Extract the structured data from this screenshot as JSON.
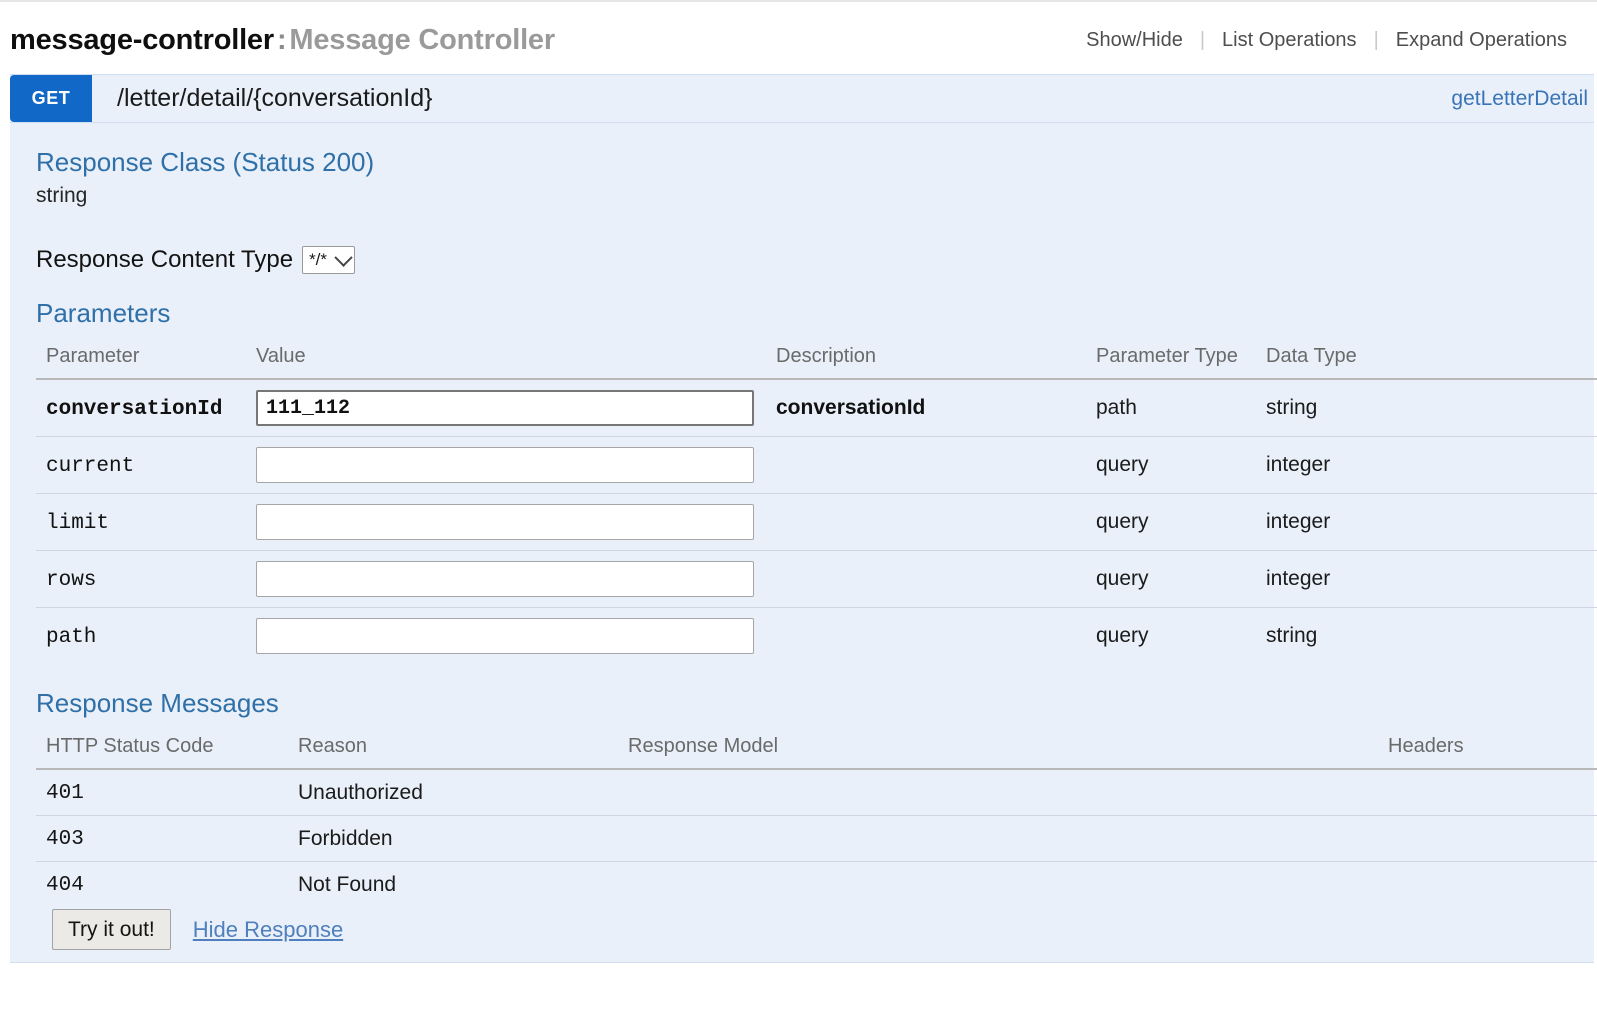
{
  "resource": {
    "name": "message-controller",
    "separator": ":",
    "description": "Message Controller",
    "options": [
      {
        "label": "Show/Hide"
      },
      {
        "label": "List Operations"
      },
      {
        "label": "Expand Operations"
      }
    ]
  },
  "operation": {
    "method": "GET",
    "path": "/letter/detail/{conversationId}",
    "nickname": "getLetterDetail"
  },
  "response_class": {
    "title": "Response Class (Status 200)",
    "model": "string",
    "content_type_label": "Response Content Type",
    "content_type_value": "*/*"
  },
  "parameters": {
    "title": "Parameters",
    "headers": [
      "Parameter",
      "Value",
      "Description",
      "Parameter Type",
      "Data Type"
    ],
    "rows": [
      {
        "name": "conversationId",
        "value": "111_112",
        "placeholder": "",
        "description": "conversationId",
        "param_type": "path",
        "data_type": "string",
        "required": true
      },
      {
        "name": "current",
        "value": "",
        "placeholder": "",
        "description": "",
        "param_type": "query",
        "data_type": "integer",
        "required": false
      },
      {
        "name": "limit",
        "value": "",
        "placeholder": "",
        "description": "",
        "param_type": "query",
        "data_type": "integer",
        "required": false
      },
      {
        "name": "rows",
        "value": "",
        "placeholder": "",
        "description": "",
        "param_type": "query",
        "data_type": "integer",
        "required": false
      },
      {
        "name": "path",
        "value": "",
        "placeholder": "",
        "description": "",
        "param_type": "query",
        "data_type": "string",
        "required": false
      }
    ]
  },
  "response_messages": {
    "title": "Response Messages",
    "headers": [
      "HTTP Status Code",
      "Reason",
      "Response Model",
      "Headers"
    ],
    "rows": [
      {
        "code": "401",
        "reason": "Unauthorized",
        "model": "",
        "headers": ""
      },
      {
        "code": "403",
        "reason": "Forbidden",
        "model": "",
        "headers": ""
      },
      {
        "code": "404",
        "reason": "Not Found",
        "model": "",
        "headers": ""
      }
    ]
  },
  "footer": {
    "submit_label": "Try it out!",
    "toggle_label": "Hide Response"
  },
  "colors": {
    "method_get": "#1168c6",
    "panel_bg": "#e9f0f9",
    "heading_blue": "#3070a8",
    "link_blue": "#3a74b8"
  }
}
